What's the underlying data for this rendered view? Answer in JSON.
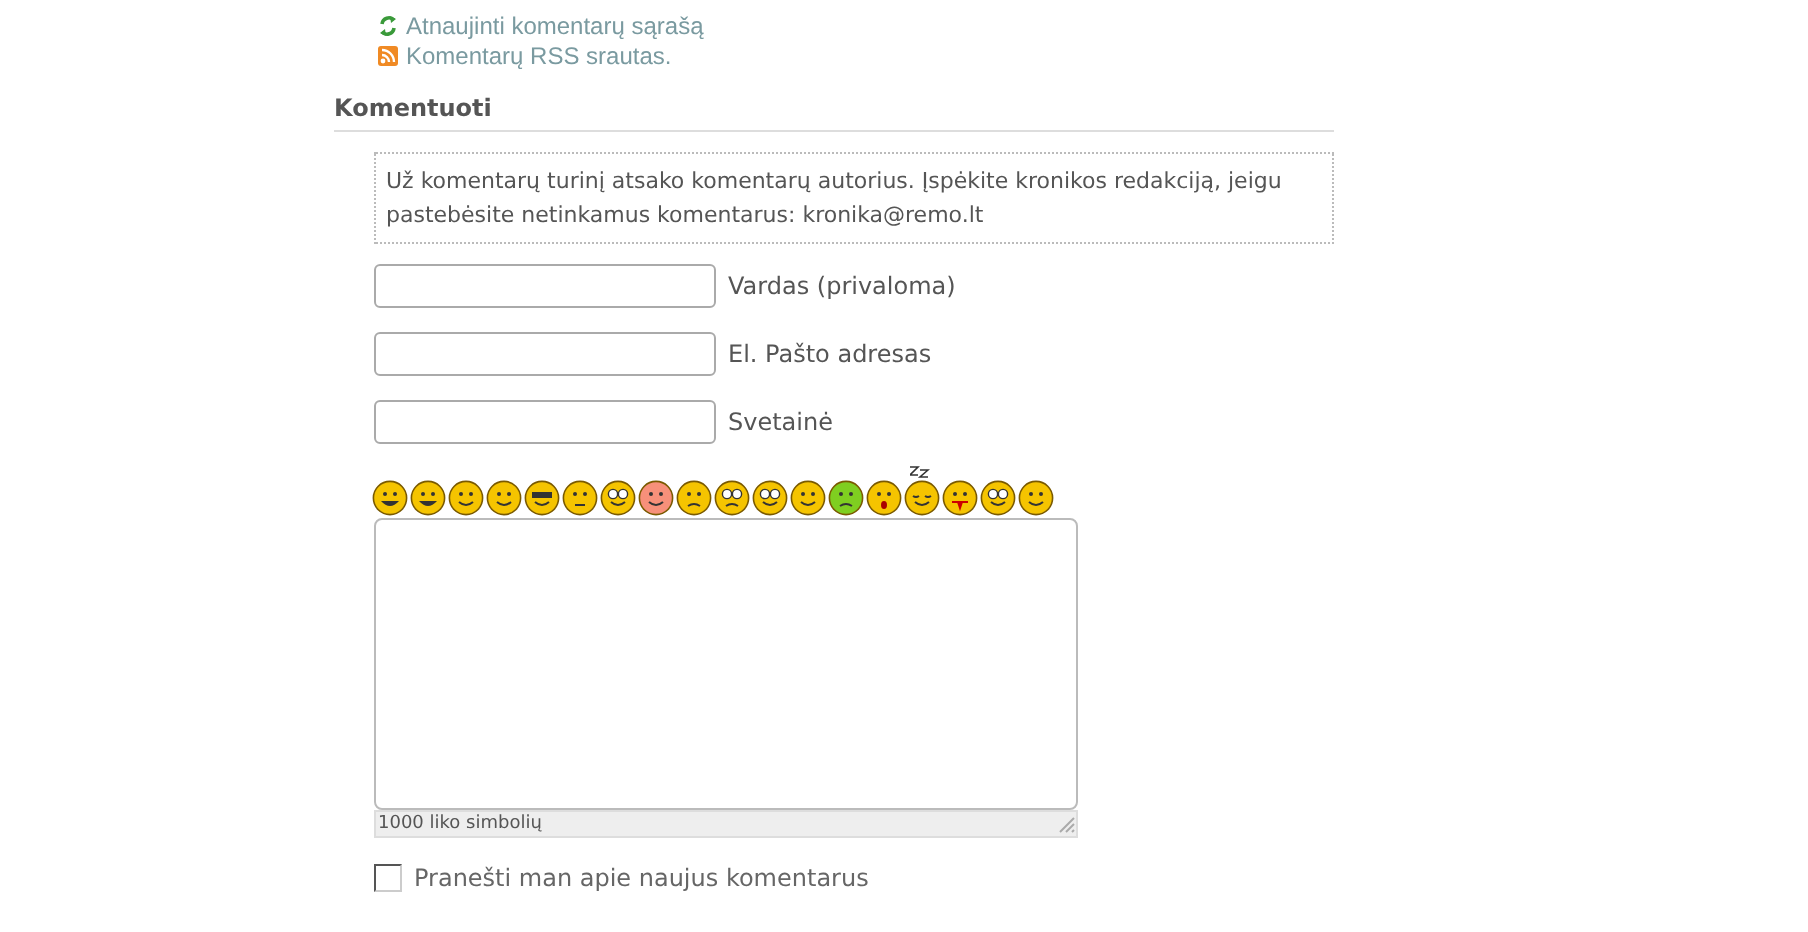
{
  "links": [
    {
      "kind": "refresh",
      "label": "Atnaujinti komentarų sąrašą"
    },
    {
      "kind": "rss",
      "label": "Komentarų RSS srautas."
    }
  ],
  "heading": "Komentuoti",
  "notice": "Už komentarų turinį atsako komentarų autorius. Įspėkite kronikos redakciją, jeigu pastebėsite netinkamus komentarus: kronika@remo.lt",
  "fields": [
    {
      "label": "Vardas (privaloma)"
    },
    {
      "label": "El. Pašto adresas"
    },
    {
      "label": "Svetainė"
    }
  ],
  "comment_box": {
    "counter": "1000 liko simbolių"
  },
  "notify": {
    "label": "Pranešti man apie naujus komentarus",
    "checked": false
  }
}
